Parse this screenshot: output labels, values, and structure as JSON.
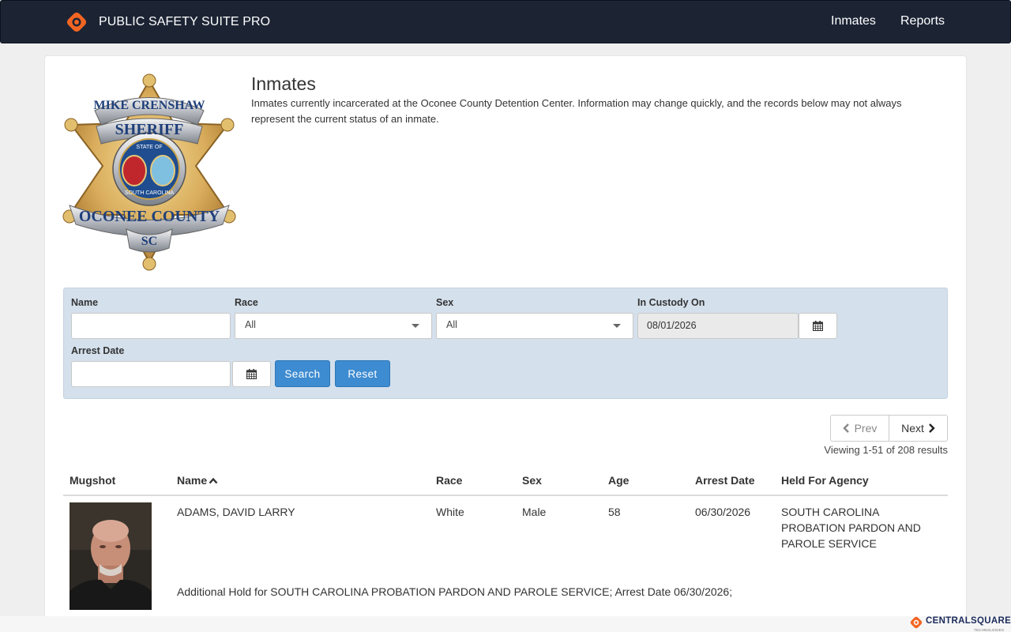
{
  "app": {
    "brand": "PUBLIC SAFETY SUITE PRO",
    "nav": [
      {
        "label": "Inmates"
      },
      {
        "label": "Reports"
      }
    ]
  },
  "badge": {
    "top_text": "MIKE CRENSHAW",
    "title": "SHERIFF",
    "seal_top": "STATE OF",
    "seal_bottom": "SOUTH CAROLINA",
    "county": "OCONEE COUNTY",
    "state": "SC"
  },
  "page": {
    "title": "Inmates",
    "description": "Inmates currently incarcerated at the Oconee County Detention Center. Information may change quickly, and the records below may not always represent the current status of an inmate."
  },
  "filters": {
    "name_label": "Name",
    "name_value": "",
    "race_label": "Race",
    "race_value": "All",
    "sex_label": "Sex",
    "sex_value": "All",
    "custody_label": "In Custody On",
    "custody_value": "08/01/2026",
    "arrest_label": "Arrest Date",
    "arrest_value": "",
    "search_label": "Search",
    "reset_label": "Reset"
  },
  "pagination": {
    "prev_label": "Prev",
    "next_label": "Next",
    "viewing": "Viewing 1-51 of 208 results"
  },
  "table": {
    "headers": {
      "mugshot": "Mugshot",
      "name": "Name",
      "race": "Race",
      "sex": "Sex",
      "age": "Age",
      "arrest_date": "Arrest Date",
      "agency": "Held For Agency"
    },
    "rows": [
      {
        "name": "ADAMS, DAVID LARRY",
        "race": "White",
        "sex": "Male",
        "age": "58",
        "arrest_date": "06/30/2026",
        "agency": "SOUTH CAROLINA PROBATION PARDON AND PAROLE SERVICE",
        "additional": "Additional Hold for SOUTH CAROLINA PROBATION PARDON AND PAROLE SERVICE; Arrest Date 06/30/2026;"
      }
    ]
  },
  "footer": {
    "logo_text": "CENTRALSQUARE",
    "logo_sub": "TECHNOLOGIES"
  },
  "colors": {
    "navbar": "#1c2434",
    "accent": "#f26522",
    "filter_bg": "#d4e0ec",
    "primary_button": "#3d8bd0"
  }
}
